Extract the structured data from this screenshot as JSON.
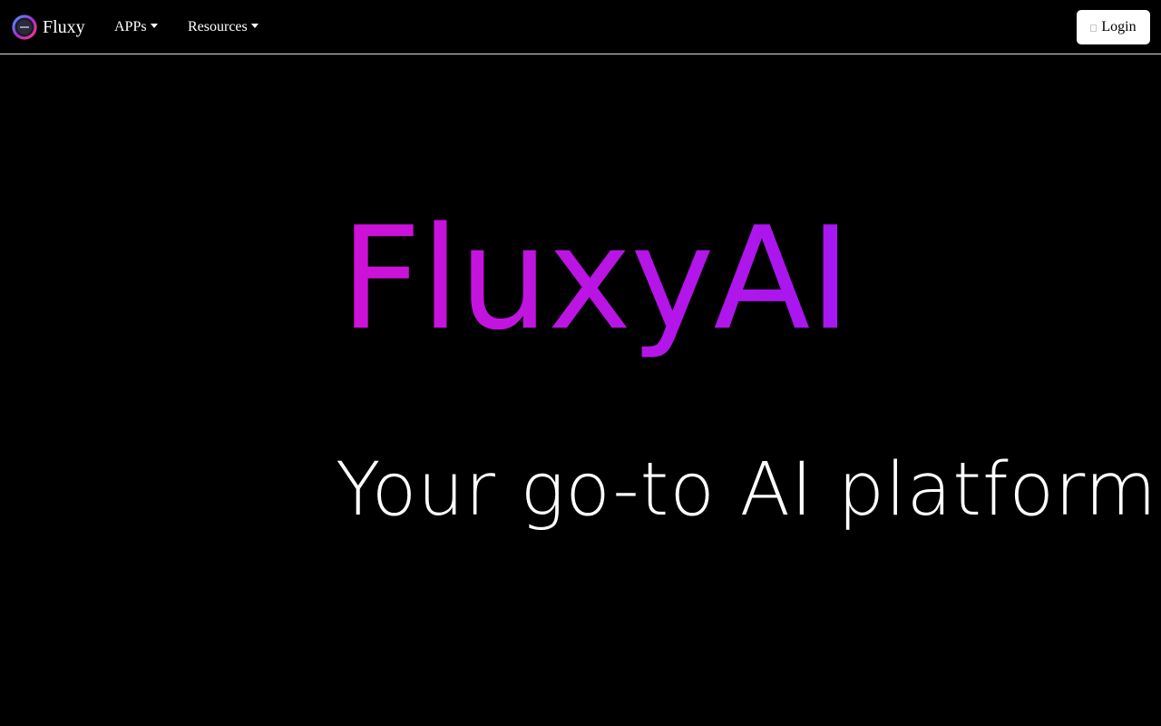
{
  "navbar": {
    "brand": {
      "name": "Fluxy",
      "logo_icon": "fluxy-logo-icon"
    },
    "menu": [
      {
        "label": "APPs",
        "icon": "caret-down-icon"
      },
      {
        "label": "Resources",
        "icon": "caret-down-icon"
      }
    ],
    "login": {
      "label": "Login",
      "icon": "login-icon"
    }
  },
  "hero": {
    "title": "FluxyAI",
    "subtitle": "Your go-to AI platform."
  },
  "colors": {
    "background": "#000000",
    "title_gradient_start": "#cf12d6",
    "title_gradient_end": "#a517f2",
    "text": "#ffffff"
  }
}
